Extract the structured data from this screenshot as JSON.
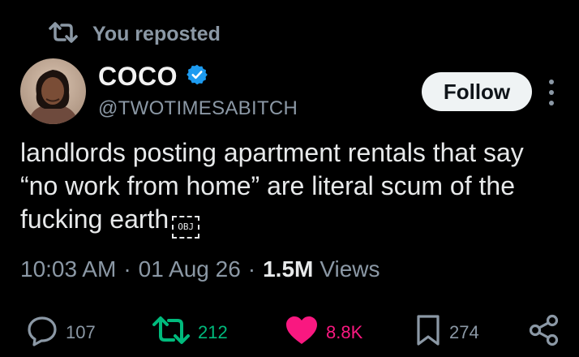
{
  "repost_banner": {
    "icon": "repost-icon",
    "text": "You reposted"
  },
  "author": {
    "display_name": "COCO",
    "verified": true,
    "verified_color": "#1d9bf0",
    "handle": "@TWOTIMESABITCH",
    "avatar": "avatar-photo"
  },
  "follow_button": {
    "label": "Follow"
  },
  "more_menu": {
    "icon": "more-vertical-icon"
  },
  "tweet": {
    "text": "landlords posting apartment rentals that say “no work from home” are literal scum of the fucking earth",
    "trailing_glyph": "OBJ"
  },
  "meta": {
    "time": "10:03 AM",
    "date": "01 Aug 26",
    "views_count": "1.5M",
    "views_label": "Views",
    "separator": "·"
  },
  "actions": {
    "reply": {
      "icon": "reply-icon",
      "count": "107"
    },
    "repost": {
      "icon": "repost-icon",
      "count": "212",
      "active": true,
      "color": "#00ba7c"
    },
    "like": {
      "icon": "heart-icon",
      "count": "8.8K",
      "active": true,
      "color": "#f91880"
    },
    "bookmark": {
      "icon": "bookmark-icon",
      "count": "274"
    },
    "share": {
      "icon": "share-icon"
    }
  },
  "colors": {
    "background": "#000000",
    "text_primary": "#e7e9ea",
    "text_secondary": "#8b98a5"
  }
}
